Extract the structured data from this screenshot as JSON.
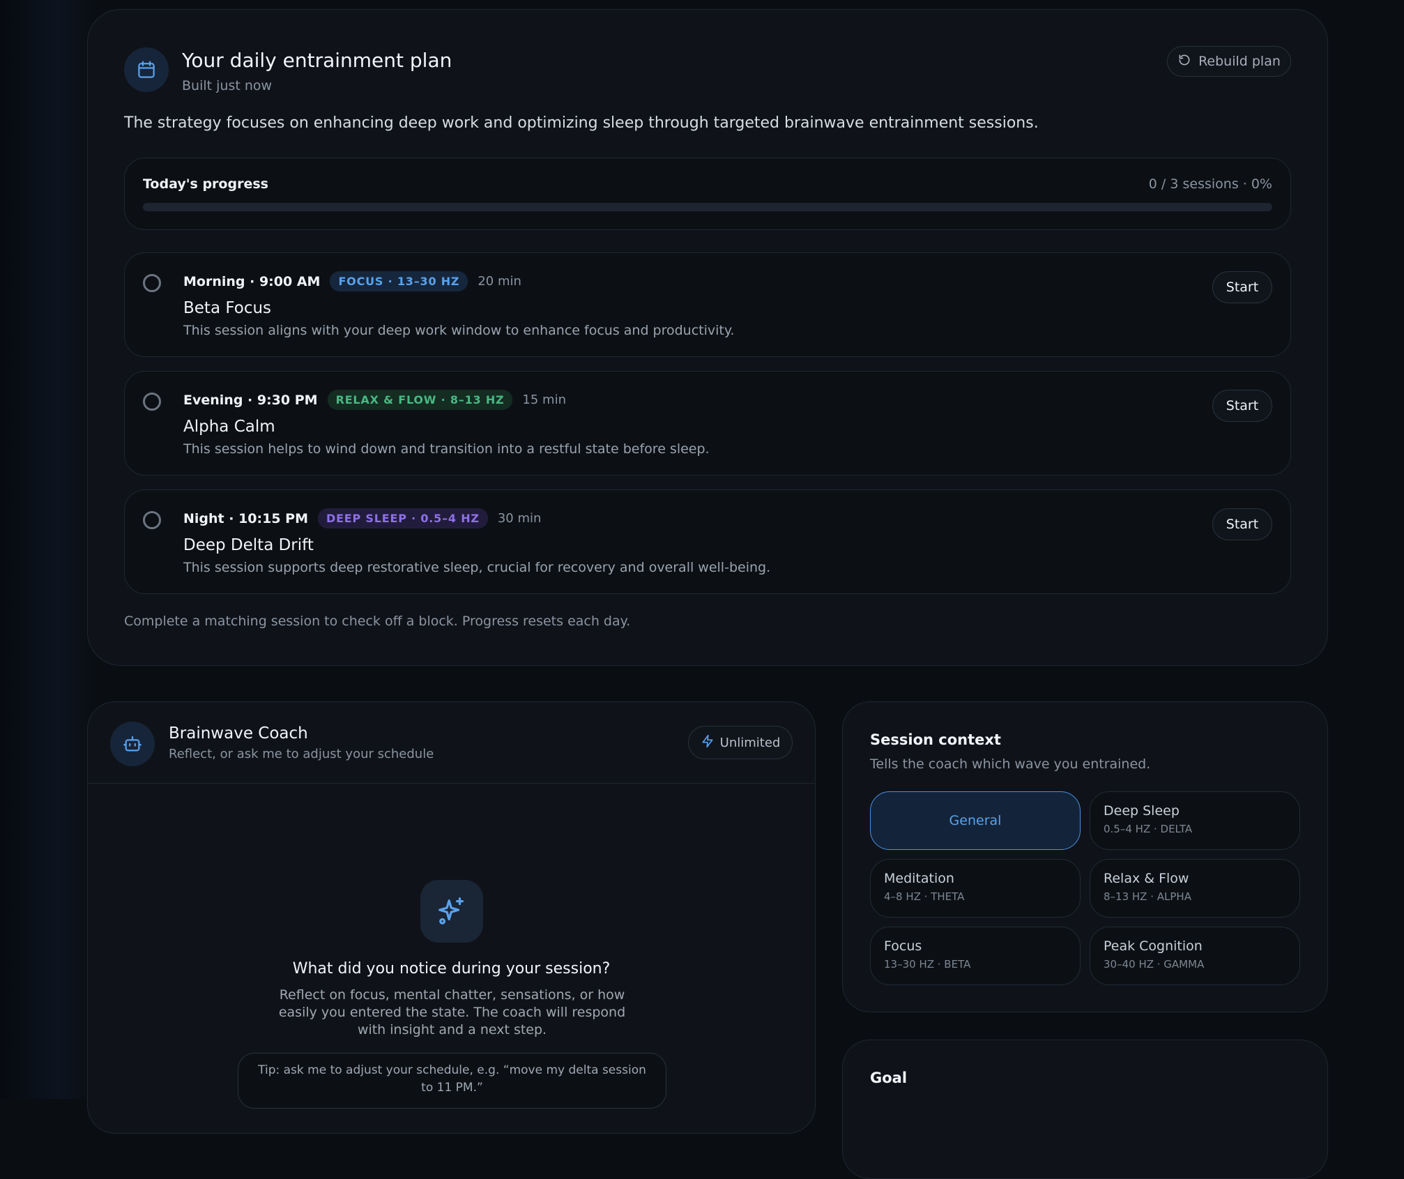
{
  "plan": {
    "title": "Your daily entrainment plan",
    "subtitle": "Built just now",
    "rebuild_label": "Rebuild plan",
    "summary": "The strategy focuses on enhancing deep work and optimizing sleep through targeted brainwave entrainment sessions.",
    "progress": {
      "label": "Today's progress",
      "value_text": "0 / 3 sessions · 0%",
      "completed": 0,
      "total": 3,
      "percent": 0
    },
    "sessions": [
      {
        "time": "Morning · 9:00 AM",
        "badge": "FOCUS · 13–30 HZ",
        "badge_color": "#5aa2ec",
        "duration": "20 min",
        "name": "Beta Focus",
        "description": "This session aligns with your deep work window to enhance focus and productivity.",
        "start_label": "Start",
        "completed": false
      },
      {
        "time": "Evening · 9:30 PM",
        "badge": "RELAX & FLOW · 8–13 HZ",
        "badge_color": "#49b883",
        "duration": "15 min",
        "name": "Alpha Calm",
        "description": "This session helps to wind down and transition into a restful state before sleep.",
        "start_label": "Start",
        "completed": false
      },
      {
        "time": "Night · 10:15 PM",
        "badge": "DEEP SLEEP · 0.5–4 HZ",
        "badge_color": "#8e71e8",
        "duration": "30 min",
        "name": "Deep Delta Drift",
        "description": "This session supports deep restorative sleep, crucial for recovery and overall well-being.",
        "start_label": "Start",
        "completed": false
      }
    ],
    "footnote": "Complete a matching session to check off a block. Progress resets each day."
  },
  "coach": {
    "title": "Brainwave Coach",
    "subtitle": "Reflect, or ask me to adjust your schedule",
    "plan_badge": "Unlimited",
    "question": "What did you notice during your session?",
    "prompt": "Reflect on focus, mental chatter, sensations, or how easily you entered the state. The coach will respond with insight and a next step.",
    "tip": "Tip: ask me to adjust your schedule, e.g. “move my delta session to 11 PM.”"
  },
  "context": {
    "title": "Session context",
    "subtitle": "Tells the coach which wave you entrained.",
    "selected": "General",
    "options": [
      {
        "name": "General",
        "sub": ""
      },
      {
        "name": "Deep Sleep",
        "sub": "0.5–4 HZ · DELTA"
      },
      {
        "name": "Meditation",
        "sub": "4–8 HZ · THETA"
      },
      {
        "name": "Relax & Flow",
        "sub": "8–13 HZ · ALPHA"
      },
      {
        "name": "Focus",
        "sub": "13–30 HZ · BETA"
      },
      {
        "name": "Peak Cognition",
        "sub": "30–40 HZ · GAMMA"
      }
    ]
  },
  "goal": {
    "title": "Goal"
  },
  "colors": {
    "accent": "#4a90e2",
    "background": "#0a0d12",
    "card": "#0f1319"
  }
}
